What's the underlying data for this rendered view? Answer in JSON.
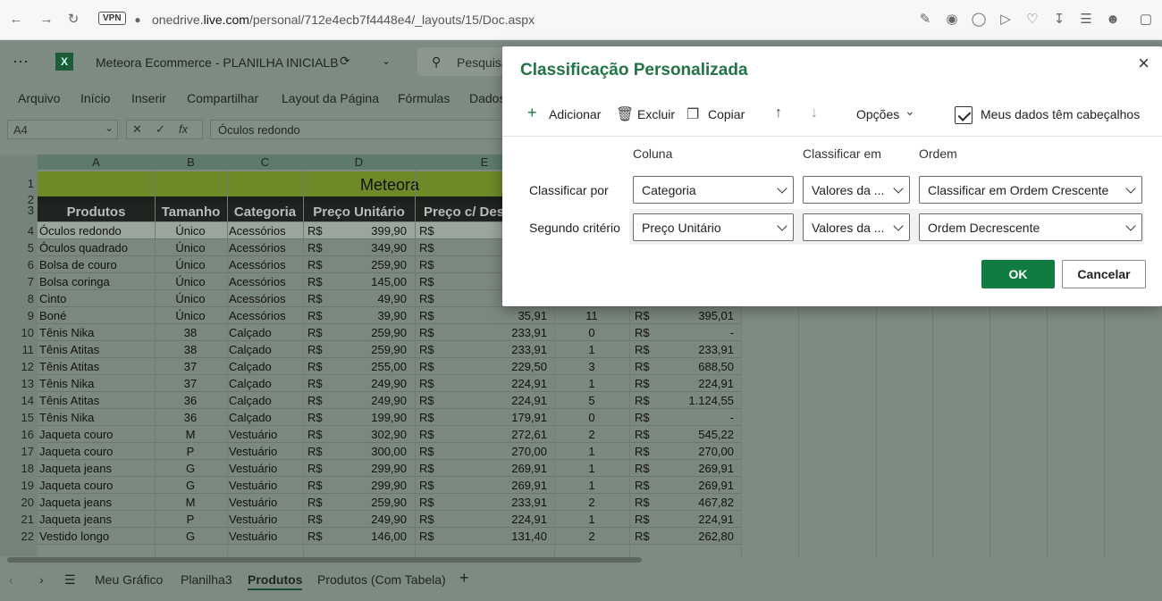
{
  "browser": {
    "vpn": "VPN",
    "url_prefix": "onedrive.",
    "url_domain": "live.com",
    "url_path": "/personal/712e4ecb7f4448e4/_layouts/15/Doc.aspx"
  },
  "app": {
    "doc_title": "Meteora Ecommerce - PLANILHA INICIALB",
    "search_placeholder": "Pesquisa",
    "menu": [
      "Arquivo",
      "Início",
      "Inserir",
      "Compartilhar",
      "Layout da Página",
      "Fórmulas",
      "Dados"
    ],
    "name_box": "A4",
    "fx": "fx",
    "formula": "Óculos redondo"
  },
  "sheet": {
    "columns": [
      "A",
      "B",
      "C",
      "D",
      "E"
    ],
    "title": "Meteora",
    "headers": [
      "Produtos",
      "Tamanho",
      "Categoria",
      "Preço Unitário",
      "Preço c/ Des"
    ],
    "rows": [
      {
        "n": "4",
        "a": "Óculos redondo",
        "b": "Único",
        "c": "Acessórios",
        "d": "399,90",
        "e": "",
        "f": "",
        "g": ""
      },
      {
        "n": "5",
        "a": "Óculos quadrado",
        "b": "Único",
        "c": "Acessórios",
        "d": "349,90",
        "e": "",
        "f": "",
        "g": ""
      },
      {
        "n": "6",
        "a": "Bolsa de couro",
        "b": "Único",
        "c": "Acessórios",
        "d": "259,90",
        "e": "",
        "f": "",
        "g": ""
      },
      {
        "n": "7",
        "a": "Bolsa coringa",
        "b": "Único",
        "c": "Acessórios",
        "d": "145,00",
        "e": "",
        "f": "",
        "g": ""
      },
      {
        "n": "8",
        "a": "Cinto",
        "b": "Único",
        "c": "Acessórios",
        "d": "49,90",
        "e": "",
        "f": "",
        "g": ""
      },
      {
        "n": "9",
        "a": "Boné",
        "b": "Único",
        "c": "Acessórios",
        "d": "39,90",
        "e": "35,91",
        "f": "11",
        "g": "395,01"
      },
      {
        "n": "10",
        "a": "Tênis Nika",
        "b": "38",
        "c": "Calçado",
        "d": "259,90",
        "e": "233,91",
        "f": "0",
        "g": "-"
      },
      {
        "n": "11",
        "a": "Tênis Atitas",
        "b": "38",
        "c": "Calçado",
        "d": "259,90",
        "e": "233,91",
        "f": "1",
        "g": "233,91"
      },
      {
        "n": "12",
        "a": "Tênis Atitas",
        "b": "37",
        "c": "Calçado",
        "d": "255,00",
        "e": "229,50",
        "f": "3",
        "g": "688,50"
      },
      {
        "n": "13",
        "a": "Tênis Nika",
        "b": "37",
        "c": "Calçado",
        "d": "249,90",
        "e": "224,91",
        "f": "1",
        "g": "224,91"
      },
      {
        "n": "14",
        "a": "Tênis Atitas",
        "b": "36",
        "c": "Calçado",
        "d": "249,90",
        "e": "224,91",
        "f": "5",
        "g": "1.124,55"
      },
      {
        "n": "15",
        "a": "Tênis Nika",
        "b": "36",
        "c": "Calçado",
        "d": "199,90",
        "e": "179,91",
        "f": "0",
        "g": "-"
      },
      {
        "n": "16",
        "a": "Jaqueta couro",
        "b": "M",
        "c": "Vestuário",
        "d": "302,90",
        "e": "272,61",
        "f": "2",
        "g": "545,22"
      },
      {
        "n": "17",
        "a": "Jaqueta couro",
        "b": "P",
        "c": "Vestuário",
        "d": "300,00",
        "e": "270,00",
        "f": "1",
        "g": "270,00"
      },
      {
        "n": "18",
        "a": "Jaqueta jeans",
        "b": "G",
        "c": "Vestuário",
        "d": "299,90",
        "e": "269,91",
        "f": "1",
        "g": "269,91"
      },
      {
        "n": "19",
        "a": "Jaqueta couro",
        "b": "G",
        "c": "Vestuário",
        "d": "299,90",
        "e": "269,91",
        "f": "1",
        "g": "269,91"
      },
      {
        "n": "20",
        "a": "Jaqueta jeans",
        "b": "M",
        "c": "Vestuário",
        "d": "259,90",
        "e": "233,91",
        "f": "2",
        "g": "467,82"
      },
      {
        "n": "21",
        "a": "Jaqueta jeans",
        "b": "P",
        "c": "Vestuário",
        "d": "249,90",
        "e": "224,91",
        "f": "1",
        "g": "224,91"
      },
      {
        "n": "22",
        "a": "Vestido longo",
        "b": "G",
        "c": "Vestuário",
        "d": "146,00",
        "e": "131,40",
        "f": "2",
        "g": "262,80"
      }
    ],
    "currency": "R$"
  },
  "tabs": [
    "Meu Gráfico",
    "Planilha3",
    "Produtos",
    "Produtos (Com Tabela)"
  ],
  "active_tab": "Produtos",
  "dialog": {
    "title": "Classificação Personalizada",
    "add": "Adicionar",
    "delete": "Excluir",
    "copy": "Copiar",
    "options": "Opções",
    "headers_check": "Meus dados têm cabeçalhos",
    "col_header": "Coluna",
    "sort_on_header": "Classificar em",
    "order_header": "Ordem",
    "rows": [
      {
        "label": "Classificar por",
        "column": "Categoria",
        "sort_on": "Valores da ...",
        "order": "Classificar em Ordem Crescente"
      },
      {
        "label": "Segundo critério",
        "column": "Preço Unitário",
        "sort_on": "Valores da ...",
        "order": "Ordem Decrescente"
      }
    ],
    "ok": "OK",
    "cancel": "Cancelar"
  },
  "colors": {
    "accent": "#107c41",
    "title_green": "#237344",
    "header_fill": "#a9c233"
  }
}
